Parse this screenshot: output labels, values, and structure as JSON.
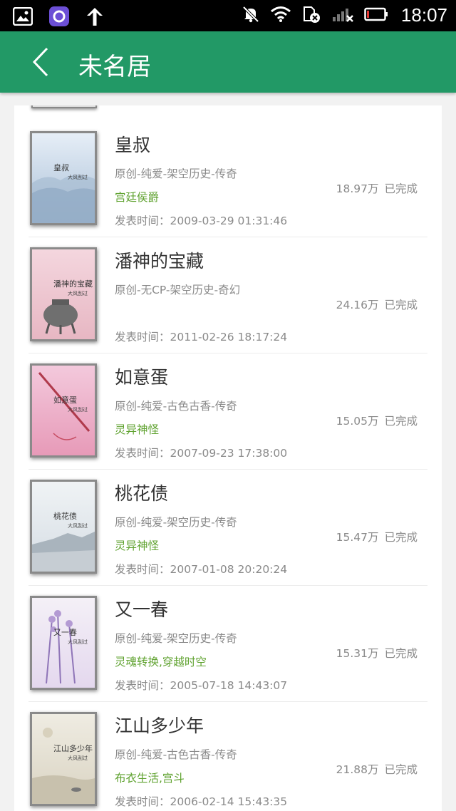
{
  "status_bar": {
    "time": "18:07"
  },
  "app_bar": {
    "title": "未名居"
  },
  "books": [
    {
      "title": "皇叔",
      "category": "原创-纯爱-架空历史-传奇",
      "tags": "宫廷侯爵",
      "published": "发表时间：2009-03-29 01:31:46",
      "words": "18.97万",
      "status": "已完成",
      "cover": {
        "title": "皇叔",
        "author": "大风刮过",
        "theme": "mountains",
        "bg1": "#e6eef7",
        "bg2": "#a9bfd6"
      }
    },
    {
      "title": "潘神的宝藏",
      "category": "原创-无CP-架空历史-奇幻",
      "tags": "",
      "published": "发表时间：2011-02-26 18:17:24",
      "words": "24.16万",
      "status": "已完成",
      "cover": {
        "title": "潘神的宝藏",
        "author": "大风刮过",
        "theme": "vessel",
        "bg1": "#f4d6de",
        "bg2": "#e7b7c3"
      }
    },
    {
      "title": "如意蛋",
      "category": "原创-纯爱-古色古香-传奇",
      "tags": "灵异神怪",
      "published": "发表时间：2007-09-23 17:38:00",
      "words": "15.05万",
      "status": "已完成",
      "cover": {
        "title": "如意蛋",
        "author": "大风刮过",
        "theme": "flute",
        "bg1": "#f3c9dc",
        "bg2": "#e79ab8"
      }
    },
    {
      "title": "桃花债",
      "category": "原创-纯爱-架空历史-传奇",
      "tags": "灵异神怪",
      "published": "发表时间：2007-01-08 20:20:24",
      "words": "15.47万",
      "status": "已完成",
      "cover": {
        "title": "桃花债",
        "author": "大风刮过",
        "theme": "rooftops",
        "bg1": "#f0f3f5",
        "bg2": "#d5dde4"
      }
    },
    {
      "title": "又一春",
      "category": "原创-纯爱-架空历史-传奇",
      "tags": "灵魂转换,穿越时空",
      "published": "发表时间：2005-07-18 14:43:07",
      "words": "15.31万",
      "status": "已完成",
      "cover": {
        "title": "又一春",
        "author": "大风刮过",
        "theme": "lavender",
        "bg1": "#f4f0f7",
        "bg2": "#e4d8ee"
      }
    },
    {
      "title": "江山多少年",
      "category": "原创-纯爱-古色古香-传奇",
      "tags": "布衣生活,宫斗",
      "published": "发表时间：2006-02-14 15:43:35",
      "words": "21.88万",
      "status": "已完成",
      "cover": {
        "title": "江山多少年",
        "author": "大风刮过",
        "theme": "sunset",
        "bg1": "#efece2",
        "bg2": "#d9d3c2"
      }
    }
  ]
}
